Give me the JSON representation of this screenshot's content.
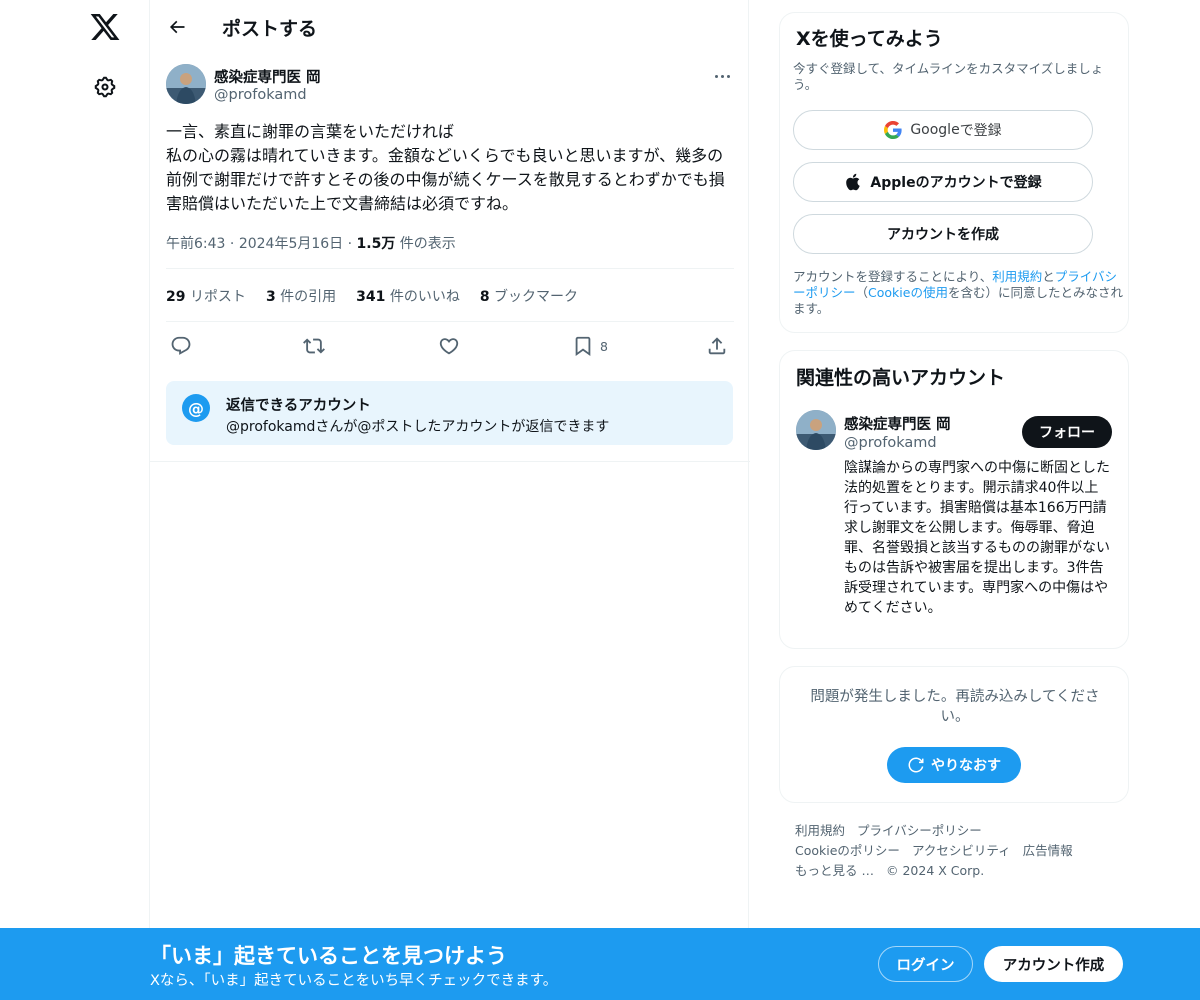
{
  "nav": {
    "logo_icon": "x-logo-icon",
    "settings_icon": "gear-icon"
  },
  "header": {
    "title": "ポストする"
  },
  "post": {
    "author_name": "感染症専門医 岡",
    "author_handle": "@profokamd",
    "text": "一言、素直に謝罪の言葉をいただければ\n私の心の霧は晴れていきます。金額などいくらでも良いと思いますが、幾多の前例で謝罪だけで許すとその後の中傷が続くケースを散見するとわずかでも損害賠償はいただいた上で文書締結は必須ですね。",
    "time": "午前6:43",
    "date": "2024年5月16日",
    "views_count": "1.5万",
    "views_label": "件の表示",
    "stats": {
      "reposts_count": "29",
      "reposts_label": "リポスト",
      "quotes_count": "3",
      "quotes_label": "件の引用",
      "likes_count": "341",
      "likes_label": "件のいいね",
      "bookmarks_count": "8",
      "bookmarks_label": "ブックマーク"
    },
    "bookmark_action_count": "8"
  },
  "reply_restriction": {
    "icon_glyph": "@",
    "title": "返信できるアカウント",
    "description": "@profokamdさんが@ポストしたアカウントが返信できます"
  },
  "signup_card": {
    "title": "Xを使ってみよう",
    "subtitle": "今すぐ登録して、タイムラインをカスタマイズしましょう。",
    "google_label_bold": "Google",
    "google_label_rest": " で登録",
    "apple_label": "Appleのアカウントで登録",
    "create_label": "アカウントを作成",
    "terms_prefix": "アカウントを登録することにより、",
    "terms_link1": "利用規約",
    "terms_and": "と",
    "terms_link2": "プライバシーポリシー",
    "terms_open": "（",
    "terms_link3": "Cookieの使用",
    "terms_suffix": "を含む）に同意したとみなされます。"
  },
  "related_card": {
    "title": "関連性の高いアカウント",
    "name": "感染症専門医 岡",
    "handle": "@profokamd",
    "follow_label": "フォロー",
    "bio": "陰謀論からの専門家への中傷に断固とした法的処置をとります。開示請求40件以上行っています。損害賠償は基本166万円請求し謝罪文を公開します。侮辱罪、脅迫罪、名誉毀損と該当するものの謝罪がないものは告訴や被害届を提出します。3件告訴受理されています。専門家への中傷はやめてください。"
  },
  "error_card": {
    "message": "問題が発生しました。再読み込みしてください。",
    "retry_label": "やりなおす"
  },
  "footer": {
    "links": [
      "利用規約",
      "プライバシーポリシー",
      "Cookieのポリシー",
      "アクセシビリティ",
      "広告情報",
      "もっと見る …"
    ],
    "copyright": "© 2024 X Corp."
  },
  "banner": {
    "title": "「いま」起きていることを見つけよう",
    "subtitle": "Xなら、「いま」起きていることをいち早くチェックできます。",
    "login_label": "ログイン",
    "signup_label": "アカウント作成"
  },
  "colors": {
    "accent": "#1d9bf0",
    "text": "#0f1419",
    "muted": "#536471",
    "reply_box_bg": "#e8f5fd"
  }
}
